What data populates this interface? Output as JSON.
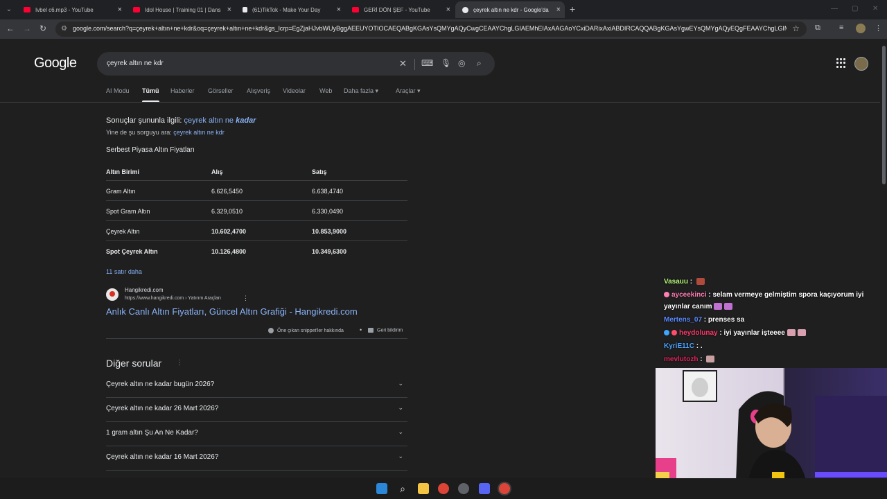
{
  "browser": {
    "tabs": [
      {
        "title": "Ivbel c6.mp3 - YouTube",
        "favicon": "youtube-icon",
        "color": "#ff0033"
      },
      {
        "title": "Idol House | Training 01 | Dans",
        "favicon": "youtube-icon",
        "color": "#ff0033"
      },
      {
        "title": "(61)TikTok - Make Your Day",
        "favicon": "tiktok-icon",
        "color": "#e8eaed"
      },
      {
        "title": "GERİ DÖN ŞEF - YouTube",
        "favicon": "youtube-icon",
        "color": "#ff0033"
      },
      {
        "title": "çeyrek altın ne kdr - Google'da",
        "favicon": "google-icon",
        "color": "#e8eaed",
        "active": true
      }
    ],
    "url": "google.com/search?q=çeyrek+altın+ne+kdr&oq=çeyrek+altın+ne+kdr&gs_lcrp=EgZjaHJvbWUyBggAEEUYOTIOCAEQABgKGAsYsQMYgAQyCwgCEAAYChgLGIAEMhEIAxAAGAoYCxiDARixAxiABDIRCAQQABgKGAsYgwEYsQMYgAQyEQgFEAAYChgLGIM..."
  },
  "google": {
    "logo": "Google",
    "query": "çeyrek altın ne kdr",
    "nav_tabs": [
      "AI Modu",
      "Tümü",
      "Haberler",
      "Görseller",
      "Alışveriş",
      "Videolar",
      "Web",
      "Daha fazla",
      "Araçlar"
    ],
    "correction": {
      "prefix": "Sonuçlar şununla ilgili: ",
      "link_plain": "çeyrek altın ne ",
      "link_emph": "kadar",
      "alt_prefix": "Yine de şu sorguyu ara: ",
      "alt_link": "çeyrek altın ne kdr"
    },
    "snippet": {
      "title": "Serbest Piyasa Altın Fiyatları",
      "headers": [
        "Altın Birimi",
        "Alış",
        "Satış"
      ],
      "rows": [
        [
          "Gram Altın",
          "6.626,5450",
          "6.638,4740"
        ],
        [
          "Spot Gram Altın",
          "6.329,0510",
          "6.330,0490"
        ],
        [
          "Çeyrek Altın",
          "10.602,4700",
          "10.853,9000"
        ],
        [
          "Spot Çeyrek Altın",
          "10.126,4800",
          "10.349,6300"
        ]
      ],
      "more": "11 satır daha",
      "source_name": "Hangikredi.com",
      "source_url": "https://www.hangikredi.com › Yatırım Araçları",
      "result_title": "Anlık Canlı Altın Fiyatları, Güncel Altın Grafiği - Hangikredi.com",
      "about": "Öne çıkan snippet'ler hakkında",
      "feedback": "Geri bildirim"
    },
    "paa": {
      "title": "Diğer sorular",
      "questions": [
        "Çeyrek altın ne kadar bugün 2026?",
        "Çeyrek altın ne kadar 26 Mart 2026?",
        "1 gram altın Şu An Ne Kadar?",
        "Çeyrek altın ne kadar 16 Mart 2026?"
      ]
    }
  },
  "chat": [
    {
      "user": "Vasauu",
      "color": "#b7f77a",
      "text": ""
    },
    {
      "user": "ayceekinci",
      "color": "#ff7eb3",
      "text": "selam vermeye gelmiştim spora kaçıyorum iyi yayınlar canım"
    },
    {
      "user": "Mertens_07",
      "color": "#5b8bff",
      "text": "prenses sa"
    },
    {
      "user": "heydolunay",
      "color": "#ff3b6b",
      "text": "iyi yayınlar işteeee"
    },
    {
      "user": "KyriE11C",
      "color": "#4aa3ff",
      "text": "."
    },
    {
      "user": "mevlutozh",
      "color": "#e0245e",
      "text": ""
    }
  ],
  "chat_sep": " : "
}
